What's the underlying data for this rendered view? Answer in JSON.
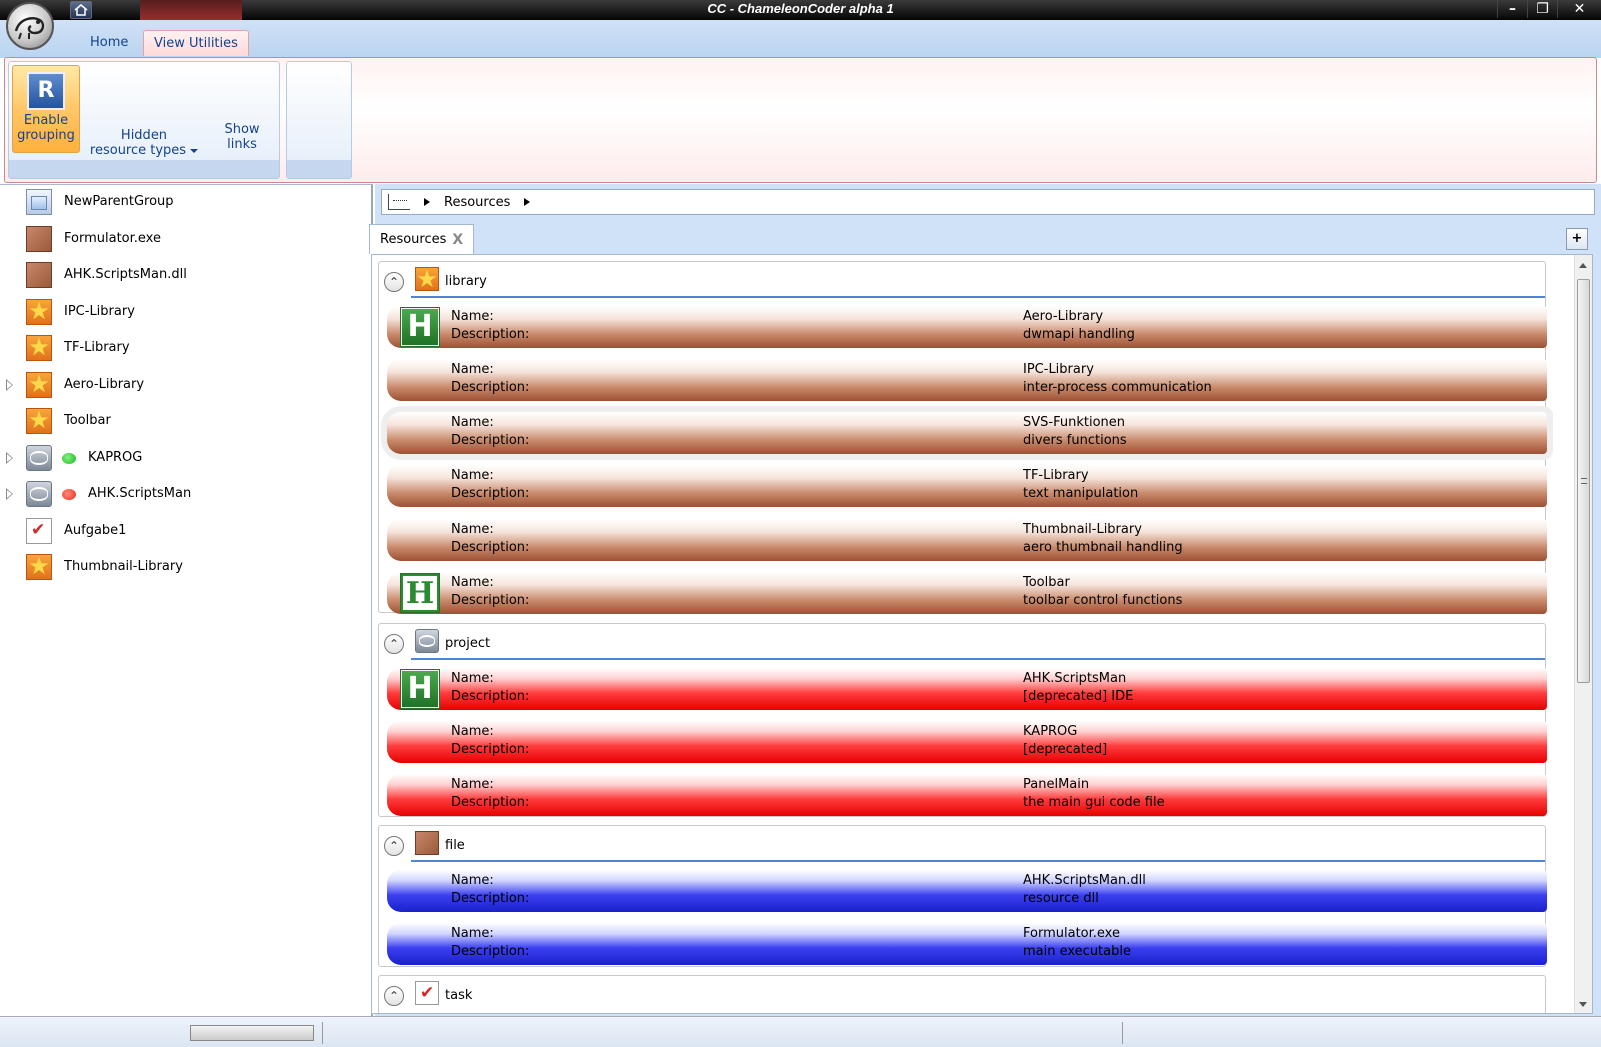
{
  "window": {
    "title": "CC - ChameleonCoder alpha 1",
    "buttons": [
      "–",
      "❐",
      "✕"
    ]
  },
  "ribbon": {
    "tabs": [
      {
        "label": "Home",
        "active": false
      },
      {
        "label": "View Utilities",
        "active": true
      }
    ],
    "enable_grouping": {
      "icon_letter": "R",
      "label_line1": "Enable",
      "label_line2": "grouping"
    },
    "hidden_types": {
      "line1": "Hidden",
      "line2": "resource types"
    },
    "show_links": {
      "line1": "Show",
      "line2": "links"
    }
  },
  "tree": {
    "items": [
      {
        "label": "NewParentGroup",
        "icon": "group-icon",
        "expandable": false,
        "status": ""
      },
      {
        "label": "Formulator.exe",
        "icon": "file-icon",
        "expandable": false,
        "status": ""
      },
      {
        "label": "AHK.ScriptsMan.dll",
        "icon": "file-icon",
        "expandable": false,
        "status": ""
      },
      {
        "label": "IPC-Library",
        "icon": "star-icon",
        "expandable": false,
        "status": ""
      },
      {
        "label": "TF-Library",
        "icon": "star-icon",
        "expandable": false,
        "status": ""
      },
      {
        "label": "Aero-Library",
        "icon": "star-icon",
        "expandable": true,
        "status": ""
      },
      {
        "label": "Toolbar",
        "icon": "star-icon",
        "expandable": false,
        "status": ""
      },
      {
        "label": "KAPROG",
        "icon": "project-icon",
        "expandable": true,
        "status": "#1fb51f"
      },
      {
        "label": "AHK.ScriptsMan",
        "icon": "project-icon",
        "expandable": true,
        "status": "#ef2a1a"
      },
      {
        "label": "Aufgabe1",
        "icon": "task-icon",
        "expandable": false,
        "status": ""
      },
      {
        "label": "Thumbnail-Library",
        "icon": "star-icon",
        "expandable": false,
        "status": ""
      }
    ]
  },
  "breadcrumb": {
    "segment": "Resources"
  },
  "doc_tab": {
    "label": "Resources",
    "close": "X",
    "add": "+"
  },
  "labels": {
    "name": "Name:",
    "description": "Description:"
  },
  "groups": {
    "library": {
      "name": "library",
      "items": [
        {
          "name": "Aero-Library",
          "description": "dwmapi handling"
        },
        {
          "name": "IPC-Library",
          "description": "inter-process communication"
        },
        {
          "name": "SVS-Funktionen",
          "description": "divers functions"
        },
        {
          "name": "TF-Library",
          "description": "text manipulation"
        },
        {
          "name": "Thumbnail-Library",
          "description": "aero thumbnail handling"
        },
        {
          "name": "Toolbar",
          "description": "toolbar control functions"
        }
      ]
    },
    "project": {
      "name": "project",
      "items": [
        {
          "name": "AHK.ScriptsMan",
          "description": "[deprecated] IDE"
        },
        {
          "name": "KAPROG",
          "description": "[deprecated]"
        },
        {
          "name": "PanelMain",
          "description": "the main gui code file"
        }
      ]
    },
    "file": {
      "name": "file",
      "items": [
        {
          "name": "AHK.ScriptsMan.dll",
          "description": "resource dll"
        },
        {
          "name": "Formulator.exe",
          "description": "main executable"
        }
      ]
    },
    "task": {
      "name": "task"
    }
  },
  "colors": {
    "library": "#9d5134",
    "project": "#e60000",
    "file": "#1a21c9",
    "accent": "#4f84d5"
  }
}
